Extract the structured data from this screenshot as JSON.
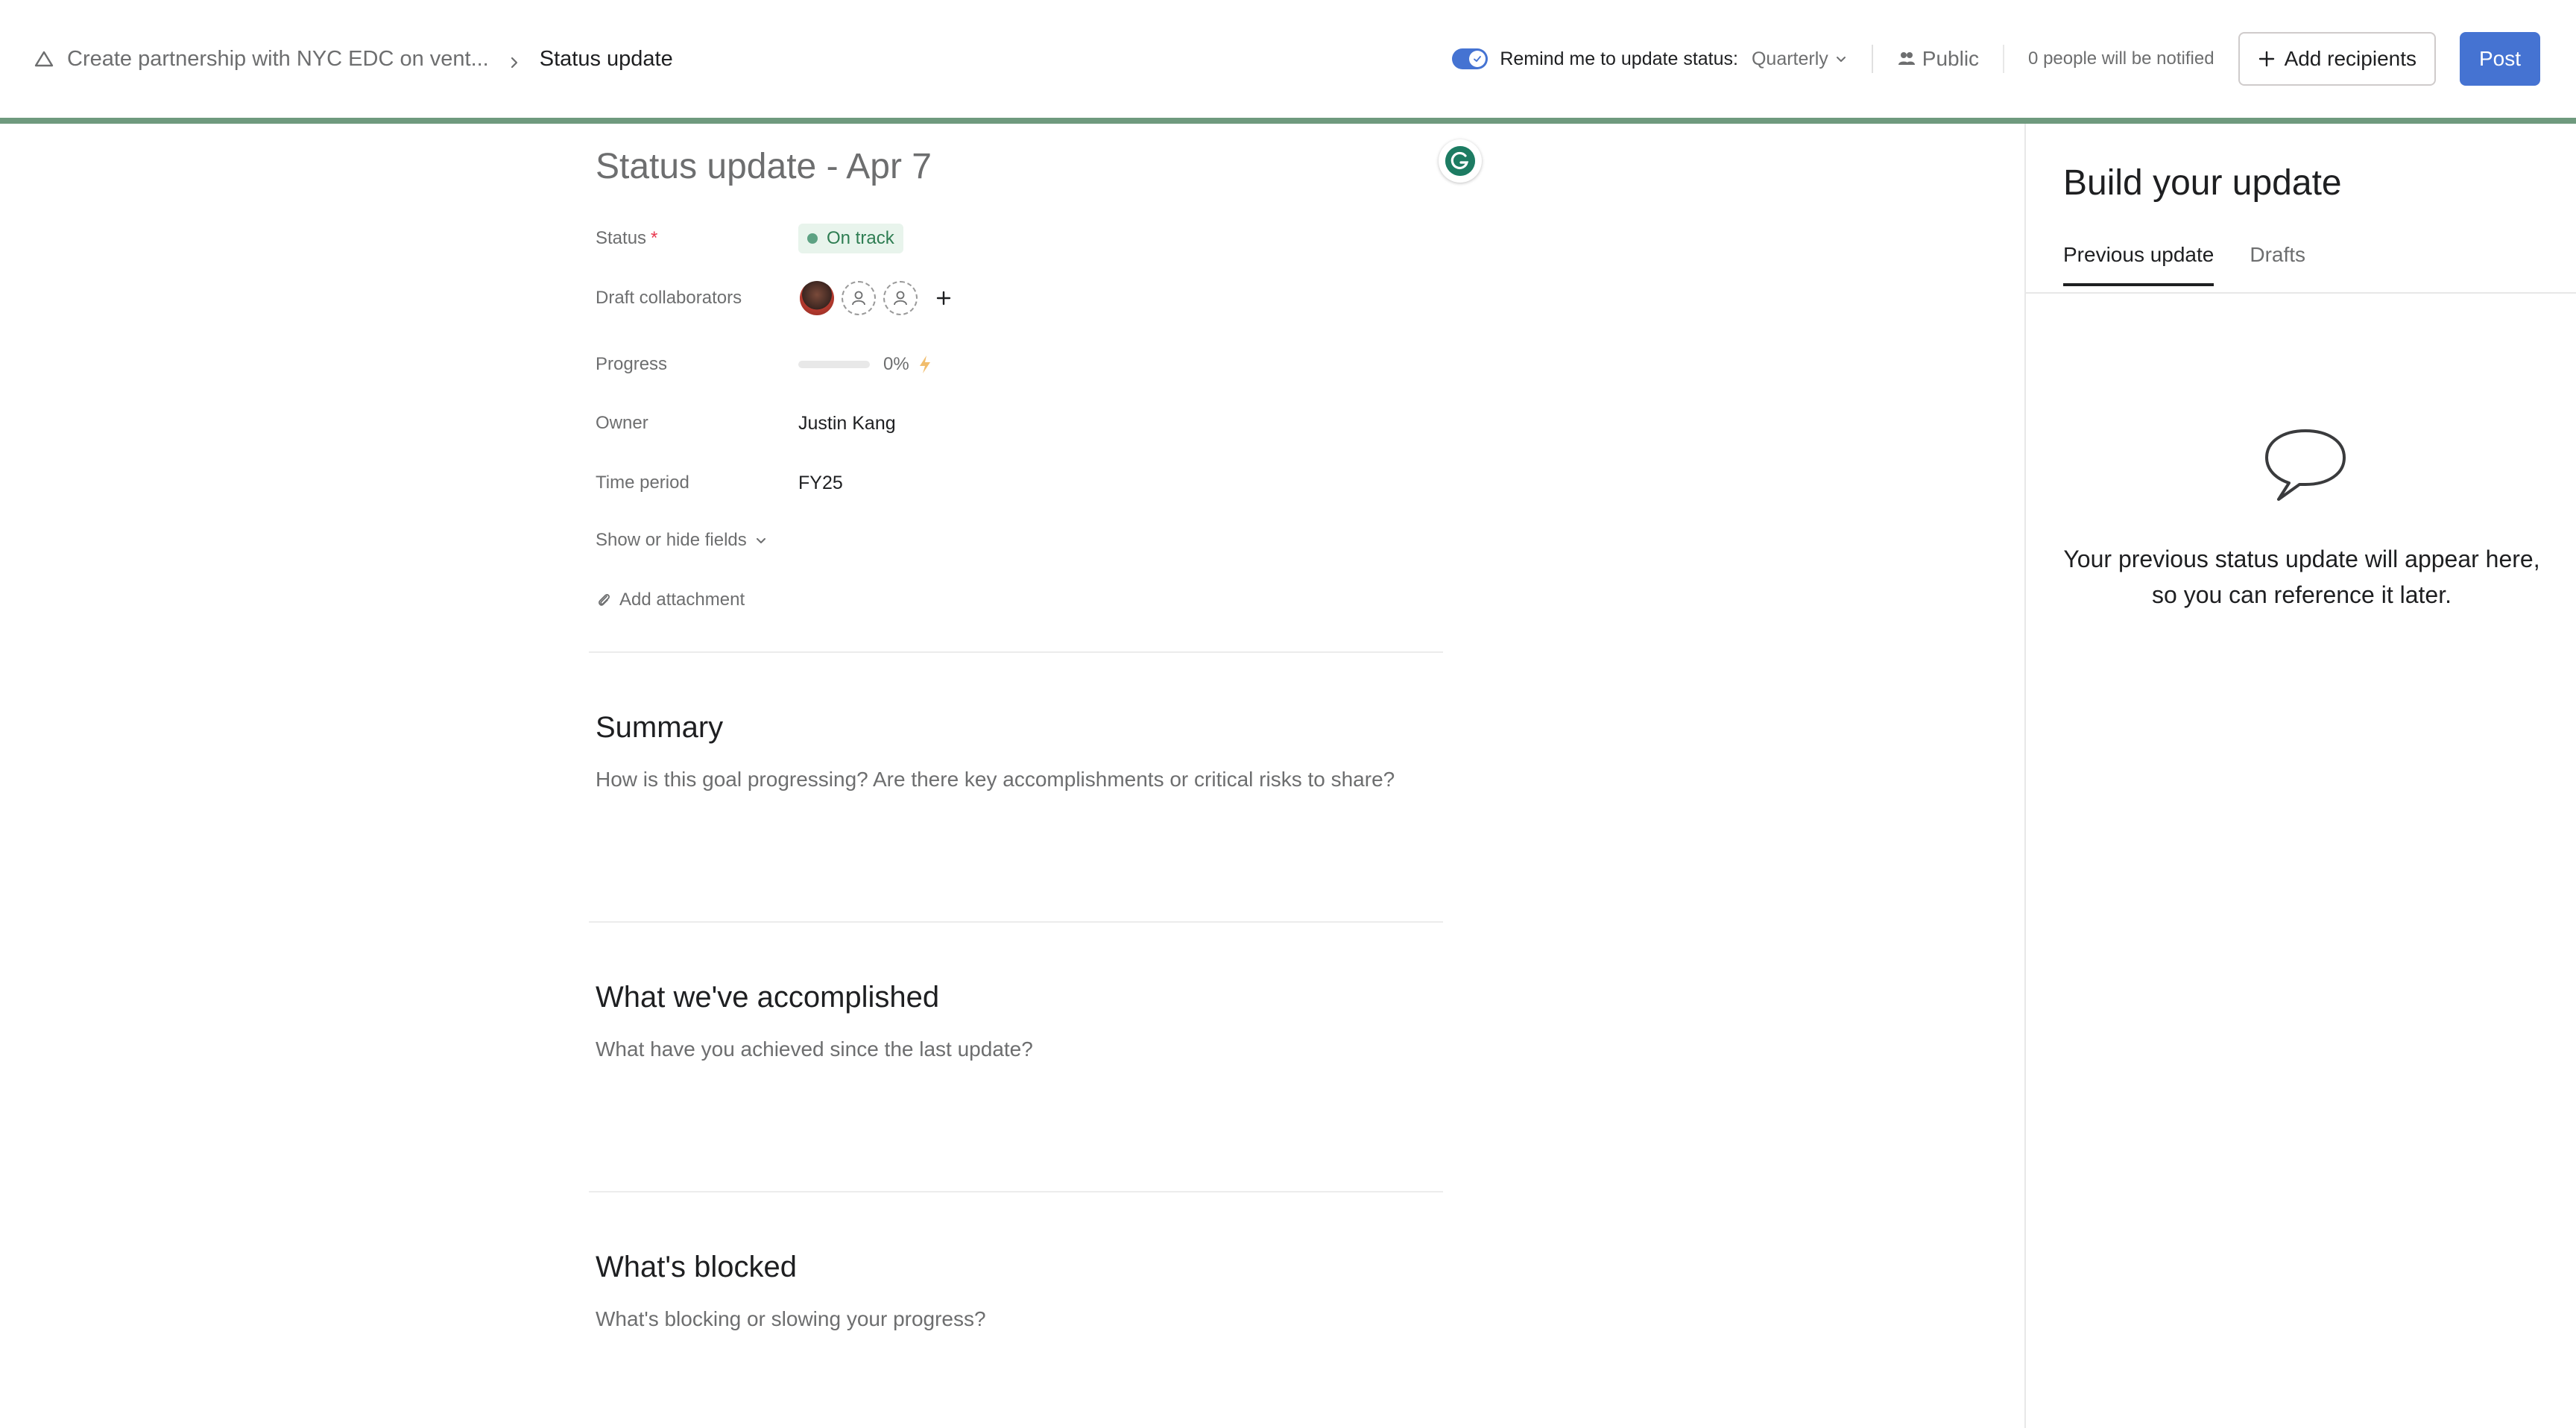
{
  "breadcrumb": {
    "goal_name": "Create partnership with NYC EDC on vent...",
    "current_page": "Status update"
  },
  "header": {
    "remind_toggle_on": true,
    "remind_label": "Remind me to update status:",
    "remind_frequency": "Quarterly",
    "visibility": "Public",
    "notified_text": "0 people will be notified",
    "add_recipients_label": "Add recipients",
    "post_label": "Post",
    "accent_color": "#4573d2"
  },
  "editor": {
    "title": "Status update - Apr 7",
    "fields": {
      "status": {
        "label": "Status",
        "required_mark": "*",
        "value": "On track",
        "color": "#5da283"
      },
      "collaborators": {
        "label": "Draft collaborators"
      },
      "progress": {
        "label": "Progress",
        "value": "0%",
        "fraction": 0
      },
      "owner": {
        "label": "Owner",
        "value": "Justin Kang"
      },
      "time_period": {
        "label": "Time period",
        "value": "FY25"
      }
    },
    "show_hide_label": "Show or hide fields",
    "add_attachment_label": "Add attachment",
    "sections": [
      {
        "heading": "Summary",
        "placeholder": "How is this goal progressing? Are there key accomplishments or critical risks to share?"
      },
      {
        "heading": "What we've accomplished",
        "placeholder": "What have you achieved since the last update?"
      },
      {
        "heading": "What's blocked",
        "placeholder": "What's blocking or slowing your progress?"
      }
    ]
  },
  "panel": {
    "title": "Build your update",
    "tabs": [
      {
        "label": "Previous update",
        "active": true
      },
      {
        "label": "Drafts",
        "active": false
      }
    ],
    "empty_message": "Your previous status update will appear here, so you can reference it later."
  }
}
